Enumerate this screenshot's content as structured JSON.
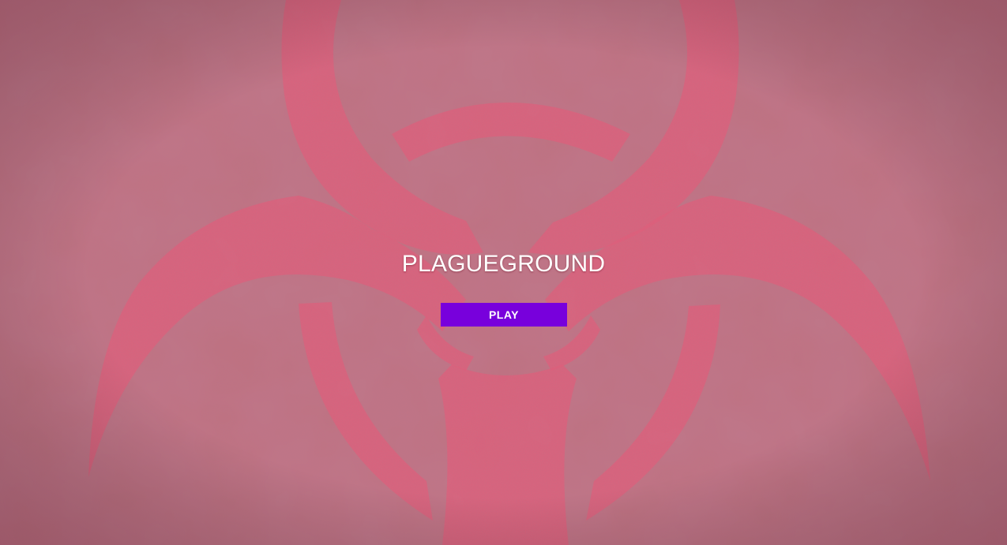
{
  "game": {
    "title": "PLAGUEGROUND",
    "play_label": "PLAY",
    "background_icon": "biohazard-symbol",
    "colors": {
      "background": "#c0707f",
      "biohazard": "#e65a78",
      "play_button": "#7800dc",
      "text": "#ffffff"
    }
  }
}
